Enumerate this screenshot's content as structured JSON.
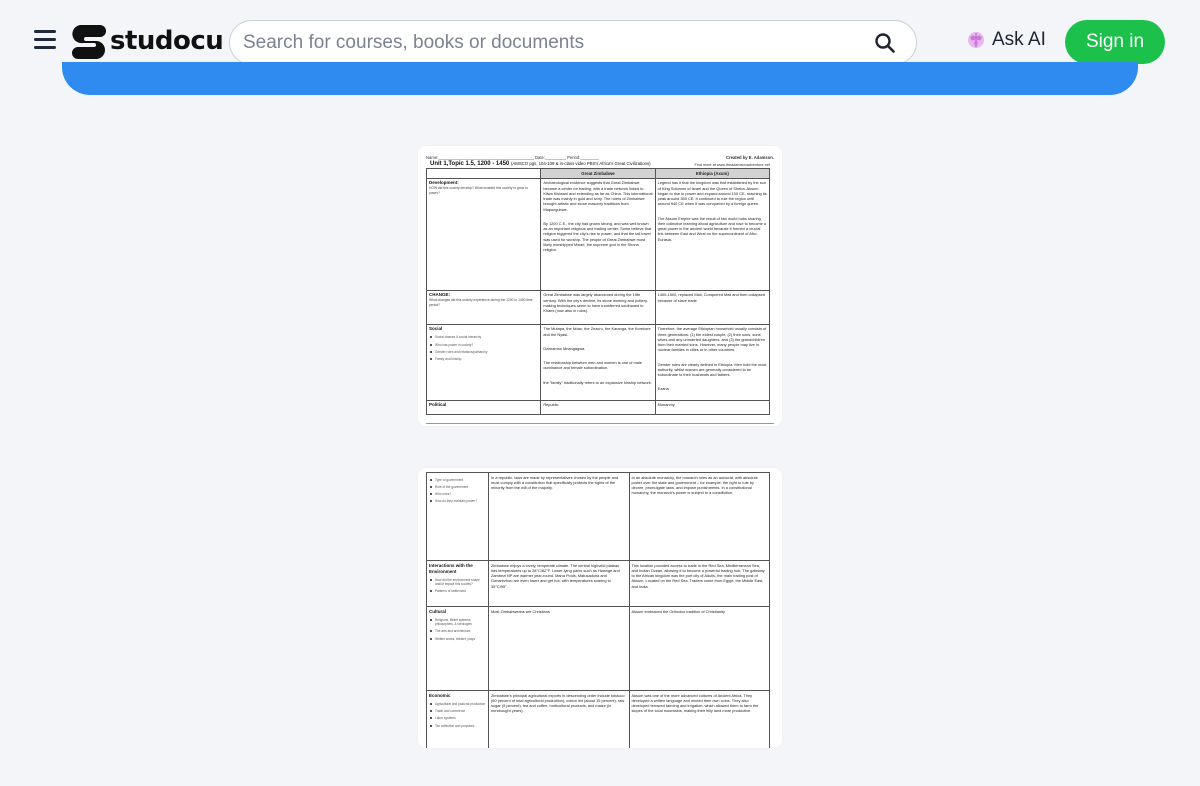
{
  "header": {
    "logo_text": "studocu",
    "search_placeholder": "Search for courses, books or documents",
    "ask_ai_label": "Ask AI",
    "signin_label": "Sign in",
    "colors": {
      "accent_green": "#1cc14c",
      "banner_blue": "#2f8bf0"
    },
    "icons": [
      "menu-icon",
      "search-icon",
      "ai-brain-icon"
    ]
  },
  "doc": {
    "topline": "Name:_________________________________________ Date:_________ Period:________",
    "created_by": "Created by E. Adamson.",
    "find_more": "Find more at www.theadamsonadventure.net",
    "unit_title": "Unit 1,Topic 1.5, 1200 - 1450",
    "unit_subtitle": "(AMSCO pgs. 104-109 & in-class video PBS's Africa's Great Civilizations)",
    "col_a": "Great Zimbabwe",
    "col_b": "Ethiopia (Axum)",
    "rows1": [
      {
        "label": "Development:",
        "sub": "HOW did this society develop? What enabled this society to grow to power?",
        "bullets": [],
        "a": [
          "Archaeological evidence suggests that Great Zimbabwe became a center for trading, with a trade network linked to Kilwa Kisiwani and extending as far as China. This international trade was mainly in gold and ivory. The rulers of Zimbabwe brought artistic and stone masonry traditions from Mapungubwe.",
          "By 1200 C.E., the city had grown strong, and was well known as an important religious and trading center. Some believe that religion triggered the city's rise to power, and that the tall tower was used for worship. The people of Great Zimbabwe most likely worshipped Mwari, the supreme god in the Shona religion."
        ],
        "b": [
          "Legend has it that the kingdom was first established by the son of King Solomon of Israel and the Queen of Sheba. Aksum began to rise in power and expand around 100 CE, reaching its peak around 350 CE. It continued to rule the region until around 940 CE when it was conquered by a foreign queen.",
          "The Aksum Empire was the result of two world hubs sharing their collective learning about agriculture and rose to become a great power in the ancient world because it formed a crucial link between East and West on the supercontinent of Afro-Eurasia."
        ]
      },
      {
        "label": "CHANGE:",
        "sub": "What changes did this society experience during the 1200 to 1450 time period?",
        "bullets": [],
        "a": [
          "Great Zimbabwe was largely abandoned during the 15th century. With the city's decline, its stone working and pottery-making techniques seem to have transferred southward to Khami (now also in ruins)."
        ],
        "b": [
          "1400-1500, replaced Mali, Conquered Mali and then collapsed because of slave trade"
        ]
      },
      {
        "label": "Social",
        "sub": "",
        "bullets": [
          "Social classes & social hierarchy",
          "Who has power in society?",
          "Gender roles and relations/patriarchy",
          "Family and kinship"
        ],
        "a": [
          "The Mutapa, the Ndau, the Zezuru, the Karanga, the Korekore and the Nyasi.",
          "Dzimamoo Mnangagwa.",
          "The relationship between men and women is one of male dominance and female subordination.",
          "the \"family\" traditionally refers to an expansive kinship network."
        ],
        "b": [
          "Therefore, the average Ethiopian household usually consists of three generations: (1) the eldest couple, (2) their sons, sons' wives and any unmarried daughters, and (3) the grandchildren from their married sons. However, many people may live in nuclear families in cities or in other countries.",
          "Gender roles are clearly defined in Ethiopia. Men hold the most authority, whilst women are generally considered to be subordinate to their husbands and fathers.",
          "Ezana"
        ]
      },
      {
        "label": "Political",
        "sub": "",
        "bullets": [],
        "a": [
          "Republic"
        ],
        "b": [
          "Monarchy"
        ]
      }
    ],
    "rows2": [
      {
        "label": "",
        "sub": "",
        "bullets": [
          "Type of government",
          "Role of the government",
          "Who rules?",
          "How do they maintain power?"
        ],
        "a": [
          "In a republic, laws are made by representatives chosen by the people and must comply with a constitution that specifically protects the rights of the minority from the will of the majority."
        ],
        "b": [
          "In an absolute monarchy, the monarch rules as an autocrat, with absolute power over the state and government – for example, the right to rule by decree, promulgate laws, and impose punishments. In a constitutional monarchy, the monarch's power is subject to a constitution."
        ]
      },
      {
        "label": "Interactions with the Environment",
        "sub": "",
        "bullets": [
          "How did the environment shape and/or impact this society?",
          "Patterns of settlement"
        ],
        "a": [
          "Zimbabwe enjoys a lovely, temperate climate. The central highveld plateau has temperatures up to 28°C/82°F. Lower-lying parks such as Hwange and Zambezi NP are warmer year-round. Mana Pools, Matusadona and Gonarezhou are even lower and get hot, with temperatures soaring to 35°C/95°."
        ],
        "b": [
          "This location provided access to trade in the Red Sea, Mediterranean Sea, and Indian Ocean, allowing it to become a powerful trading hub. The gateway to the African kingdom was the port city of Adulis, the main trading post of Aksum. Located on the Red Sea, Traders come from Egypt, the Middle East, and India."
        ]
      },
      {
        "label": "Cultural",
        "sub": "",
        "bullets": [
          "Religions, Belief systems, philosophies, & ideologies",
          "The arts and architecture",
          "Written works, theater, plays"
        ],
        "a": [
          "Most Zimbabweans are Christians"
        ],
        "b": [
          "Aksum embraced the Orthodox tradition of Christianity"
        ]
      },
      {
        "label": "Economic",
        "sub": "",
        "bullets": [
          "Agricultural and pastoral production",
          "Trade and commerce",
          "Labor systems",
          "Tax collection and purposes"
        ],
        "a": [
          "Zimbabwe's principal agricultural exports in descending order include tobacco (60 percent of total agricultural production), cotton lint (about 15 percent), raw sugar (9 percent), tea and coffee, horticultural products, and maize (in nondrought years)."
        ],
        "b": [
          "Aksum was one of the more advanced cultures of Ancient Africa. They developed a written language and minted their own coins. They also developed terraced farming and irrigation, which allowed them to farm the slopes of the local mountains, making their hilly land more productive."
        ]
      }
    ]
  }
}
